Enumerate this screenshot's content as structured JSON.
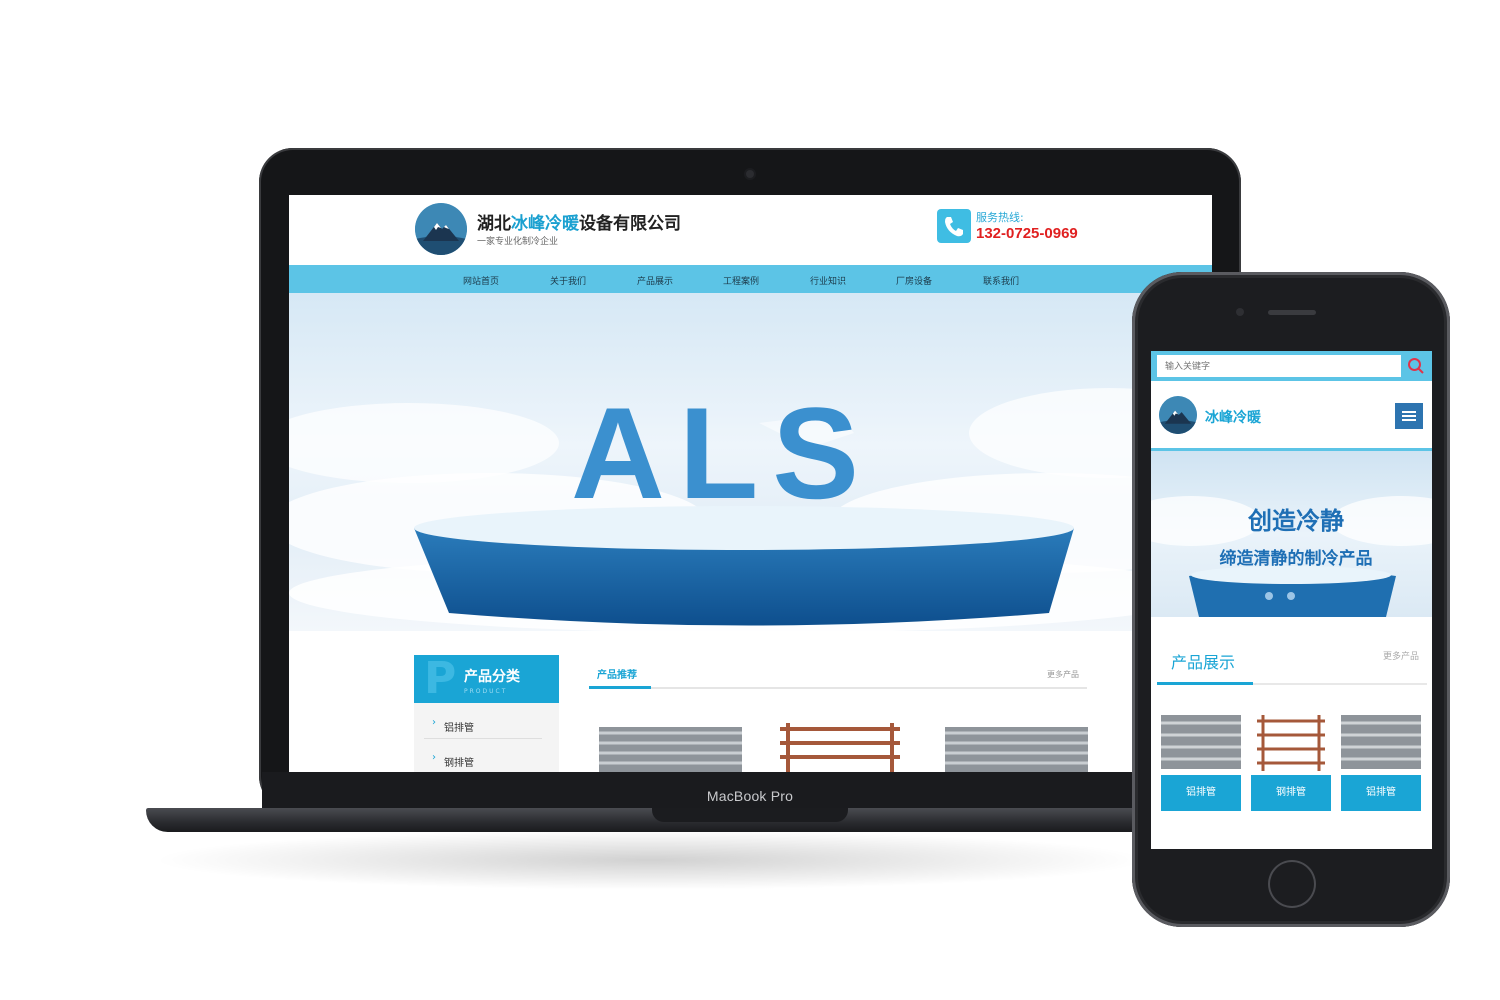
{
  "laptop": {
    "device_label": "MacBook Pro",
    "site": {
      "company_name_prefix": "湖北",
      "company_name_highlight": "冰峰冷暖",
      "company_name_suffix": "设备有限公司",
      "slogan": "一家专业化制冷企业",
      "hotline_label": "服务热线:",
      "hotline_number": "132-0725-0969",
      "nav": [
        "网站首页",
        "关于我们",
        "产品展示",
        "工程案例",
        "行业知识",
        "厂房设备",
        "联系我们"
      ],
      "banner_text": "ALS",
      "sidebar": {
        "title": "产品分类",
        "title_letter": "P",
        "title_sub": "PRODUCT",
        "items": [
          "铝排管",
          "钢排管"
        ]
      },
      "main": {
        "tab": "产品推荐",
        "more": "更多产品"
      }
    }
  },
  "phone": {
    "search_placeholder": "输入关键字",
    "site_name": "冰峰冷暖",
    "banner_line1": "创造冷静",
    "banner_line2": "缔造清静的制冷产品",
    "section_title": "产品展示",
    "section_more": "更多产品",
    "products": [
      "铝排管",
      "钢排管",
      "铝排管"
    ]
  },
  "colors": {
    "accent": "#1aa5d5",
    "nav_bg": "#5cc4e6",
    "hotline": "#e02020",
    "menu_button": "#2d74b0"
  }
}
